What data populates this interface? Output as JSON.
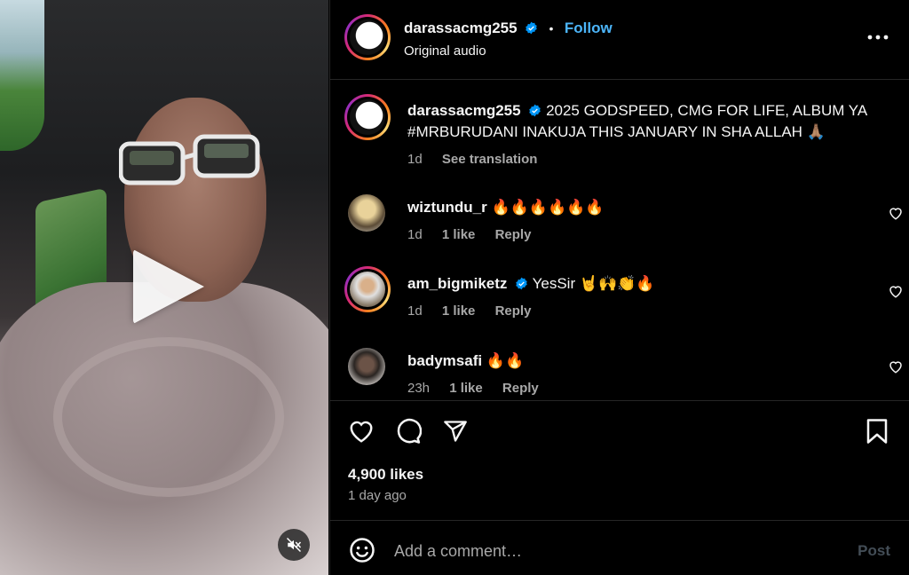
{
  "header": {
    "username": "darassacmg255",
    "separator": "•",
    "follow_label": "Follow",
    "audio_label": "Original audio",
    "more_icon": "more-horizontal-icon"
  },
  "caption": {
    "username": "darassacmg255",
    "text": "2025 GODSPEED, CMG FOR LIFE, ALBUM YA #MRBURUDANI INAKUJA THIS JANUARY IN SHA ALLAH 🙏🏽",
    "time": "1d",
    "translate_label": "See translation"
  },
  "comments": [
    {
      "username": "wiztundu_r",
      "text": "🔥🔥🔥🔥🔥🔥",
      "time": "1d",
      "likes": "1 like",
      "reply_label": "Reply",
      "verified": false
    },
    {
      "username": "am_bigmiketz",
      "text": "YesSir 🤘🙌👏🔥",
      "time": "1d",
      "likes": "1 like",
      "reply_label": "Reply",
      "verified": true
    },
    {
      "username": "badymsafi",
      "text": "🔥🔥",
      "time": "23h",
      "likes": "1 like",
      "reply_label": "Reply",
      "verified": false
    }
  ],
  "actions": {
    "likes_count": "4,900 likes",
    "posted": "1 day ago",
    "icons": [
      "heart-icon",
      "comment-icon",
      "share-icon",
      "bookmark-icon"
    ]
  },
  "composer": {
    "placeholder": "Add a comment…",
    "post_label": "Post",
    "emoji_icon": "emoji-icon"
  },
  "colors": {
    "background": "#000000",
    "divider": "#262626",
    "link_blue": "#4cb5f9",
    "muted_text": "#a8a8a8",
    "verified_blue": "#0095f6"
  },
  "video": {
    "controls": [
      "play-icon",
      "mute-icon"
    ]
  }
}
